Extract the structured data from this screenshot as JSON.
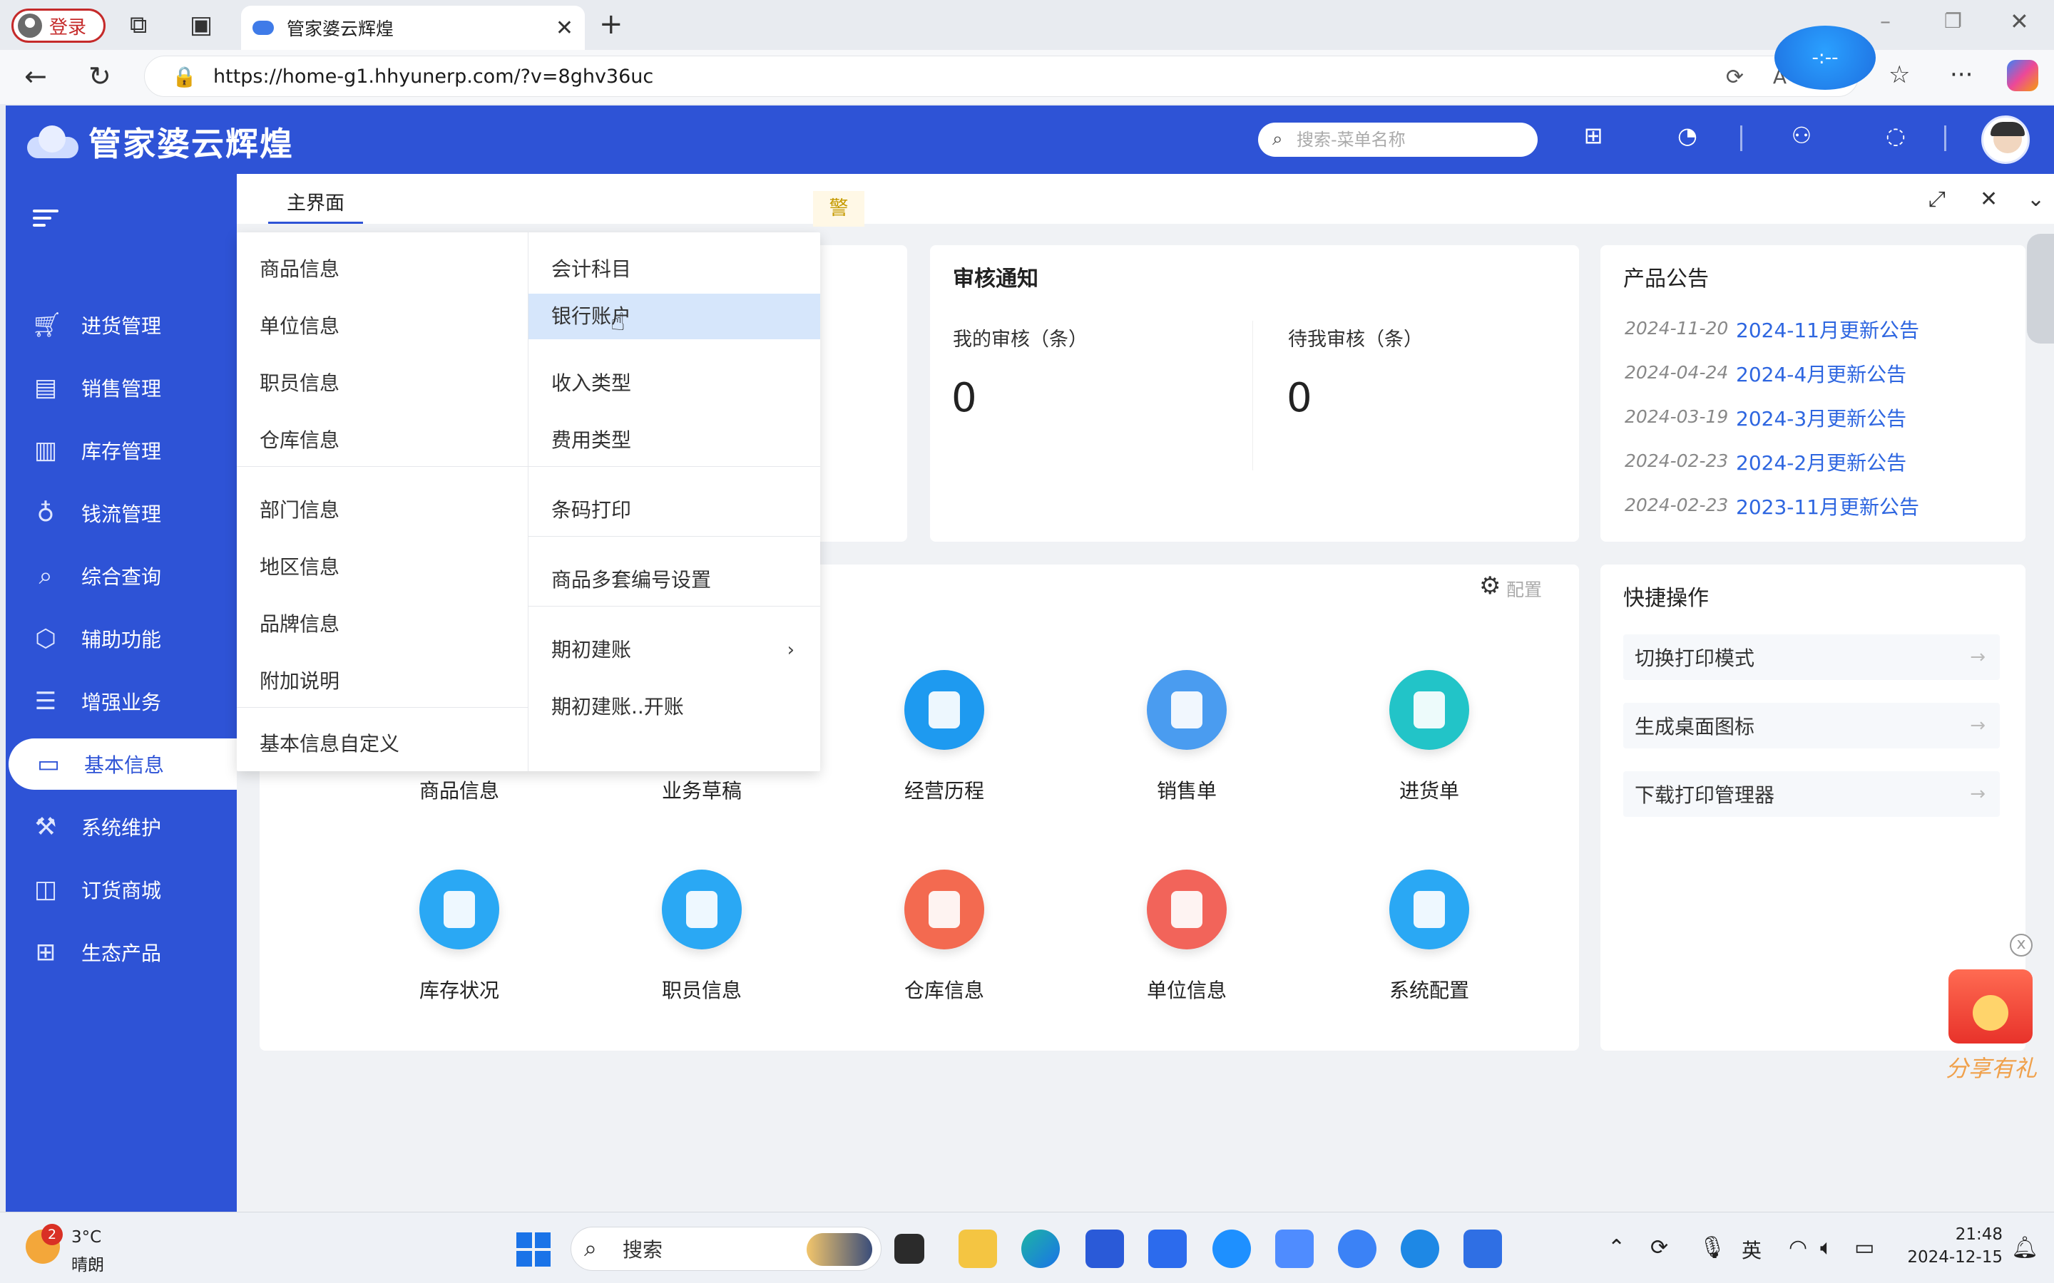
{
  "browser": {
    "login_label": "登录",
    "tab_title": "管家婆云辉煌",
    "tab_close": "✕",
    "new_tab": "+",
    "url": "https://home-g1.hhyunerp.com/?v=8ghv36uc",
    "ext_badge": "-:--"
  },
  "app": {
    "brand": "管家婆云辉煌",
    "search": {
      "placeholder": "搜索-菜单名称"
    },
    "tabs": [
      {
        "label": "主界面"
      }
    ]
  },
  "sidebar": {
    "items": [
      {
        "label": "进货管理",
        "icon": "cart-icon"
      },
      {
        "label": "销售管理",
        "icon": "sales-chart-icon"
      },
      {
        "label": "库存管理",
        "icon": "inventory-box-icon"
      },
      {
        "label": "钱流管理",
        "icon": "money-bag-icon"
      },
      {
        "label": "综合查询",
        "icon": "query-search-icon"
      },
      {
        "label": "辅助功能",
        "icon": "assist-hexagon-icon"
      },
      {
        "label": "增强业务",
        "icon": "enhanced-doc-icon"
      },
      {
        "label": "基本信息",
        "icon": "basic-info-doc-icon",
        "active": true
      },
      {
        "label": "系统维护",
        "icon": "maintenance-tool-icon"
      },
      {
        "label": "订货商城",
        "icon": "shop-bag-icon"
      },
      {
        "label": "生态产品",
        "icon": "apps-grid-icon"
      }
    ]
  },
  "dropdown": {
    "left": [
      "商品信息",
      "单位信息",
      "职员信息",
      "仓库信息",
      "部门信息",
      "地区信息",
      "品牌信息",
      "附加说明",
      "基本信息自定义"
    ],
    "right": [
      "会计科目",
      "银行账户",
      "收入类型",
      "费用类型",
      "条码打印",
      "商品多套编号设置",
      "期初建账",
      "期初建账..开账"
    ],
    "highlighted": "银行账户"
  },
  "warn_chip": "警",
  "audit": {
    "title": "审核通知",
    "mine_label": "我的审核（条）",
    "mine_value": "0",
    "pending_label": "待我审核（条）",
    "pending_value": "0"
  },
  "announcements": {
    "title": "产品公告",
    "items": [
      {
        "date": "2024-11-20",
        "title": "2024-11月更新公告"
      },
      {
        "date": "2024-04-24",
        "title": "2024-4月更新公告"
      },
      {
        "date": "2024-03-19",
        "title": "2024-3月更新公告"
      },
      {
        "date": "2024-02-23",
        "title": "2024-2月更新公告"
      },
      {
        "date": "2024-02-23",
        "title": "2023-11月更新公告"
      }
    ]
  },
  "shortcuts": {
    "config_label": "配置",
    "tiles": [
      {
        "label": "商品信息",
        "color": "#2a9df4"
      },
      {
        "label": "业务草稿",
        "color": "#2a9df4"
      },
      {
        "label": "经营历程",
        "color": "#1e9af0"
      },
      {
        "label": "销售单",
        "color": "#4a9cf0"
      },
      {
        "label": "进货单",
        "color": "#22c4c8"
      },
      {
        "label": "库存状况",
        "color": "#2aa8f4"
      },
      {
        "label": "职员信息",
        "color": "#2aa8f4"
      },
      {
        "label": "仓库信息",
        "color": "#f36a50"
      },
      {
        "label": "单位信息",
        "color": "#f2645a"
      },
      {
        "label": "系统配置",
        "color": "#2aa8f4"
      }
    ]
  },
  "quick": {
    "title": "快捷操作",
    "items": [
      "切换打印模式",
      "生成桌面图标",
      "下载打印管理器"
    ]
  },
  "promo": {
    "text": "分享有礼"
  },
  "taskbar": {
    "weather_badge": "2",
    "temperature": "3°C",
    "weather": "晴朗",
    "search_label": "搜索",
    "ime": "英",
    "time": "21:48",
    "date": "2024-12-15"
  }
}
